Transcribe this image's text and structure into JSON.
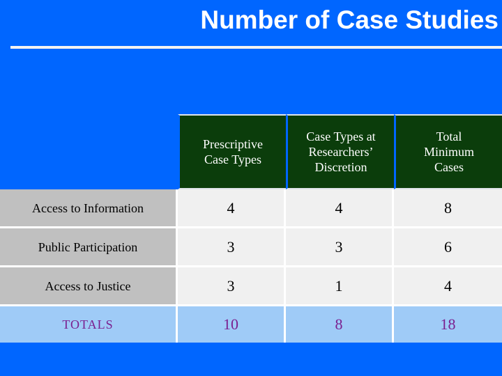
{
  "slide": {
    "title": "Number of Case Studies",
    "background_color": "#0066ff",
    "title_color": "#ffffff",
    "rule_color": "#f2f2f2"
  },
  "table": {
    "header_background": "#0b3d0b",
    "header_text_color": "#ffffff",
    "label_background": "#c0c0c0",
    "data_background": "#f0f0f0",
    "totals_background": "#9fcbf7",
    "totals_text_color": "#7b1f8f",
    "corner_header": "",
    "columns": [
      "Prescriptive Case Types",
      "Case Types at Researchers’ Discretion",
      "Total Minimum Cases"
    ],
    "column_lines": [
      [
        "Prescriptive",
        "Case Types"
      ],
      [
        "Case Types at",
        "Researchers’",
        "Discretion"
      ],
      [
        "Total",
        "Minimum",
        "Cases"
      ]
    ],
    "rows": [
      {
        "label": "Access to Information",
        "values": [
          "4",
          "4",
          "8"
        ]
      },
      {
        "label": "Public Participation",
        "values": [
          "3",
          "3",
          "6"
        ]
      },
      {
        "label": "Access to Justice",
        "values": [
          "3",
          "1",
          "4"
        ]
      }
    ],
    "totals": {
      "label": "TOTALS",
      "values": [
        "10",
        "8",
        "18"
      ]
    }
  },
  "chart_data": {
    "type": "table",
    "title": "Number of Case Studies",
    "categories": [
      "Access to Information",
      "Public Participation",
      "Access to Justice"
    ],
    "series": [
      {
        "name": "Prescriptive Case Types",
        "values": [
          4,
          3,
          3
        ],
        "total": 10
      },
      {
        "name": "Case Types at Researchers’ Discretion",
        "values": [
          4,
          3,
          1
        ],
        "total": 8
      },
      {
        "name": "Total Minimum Cases",
        "values": [
          8,
          6,
          4
        ],
        "total": 18
      }
    ],
    "totals_row_label": "TOTALS",
    "totals": [
      10,
      8,
      18
    ],
    "xlabel": "",
    "ylabel": ""
  }
}
